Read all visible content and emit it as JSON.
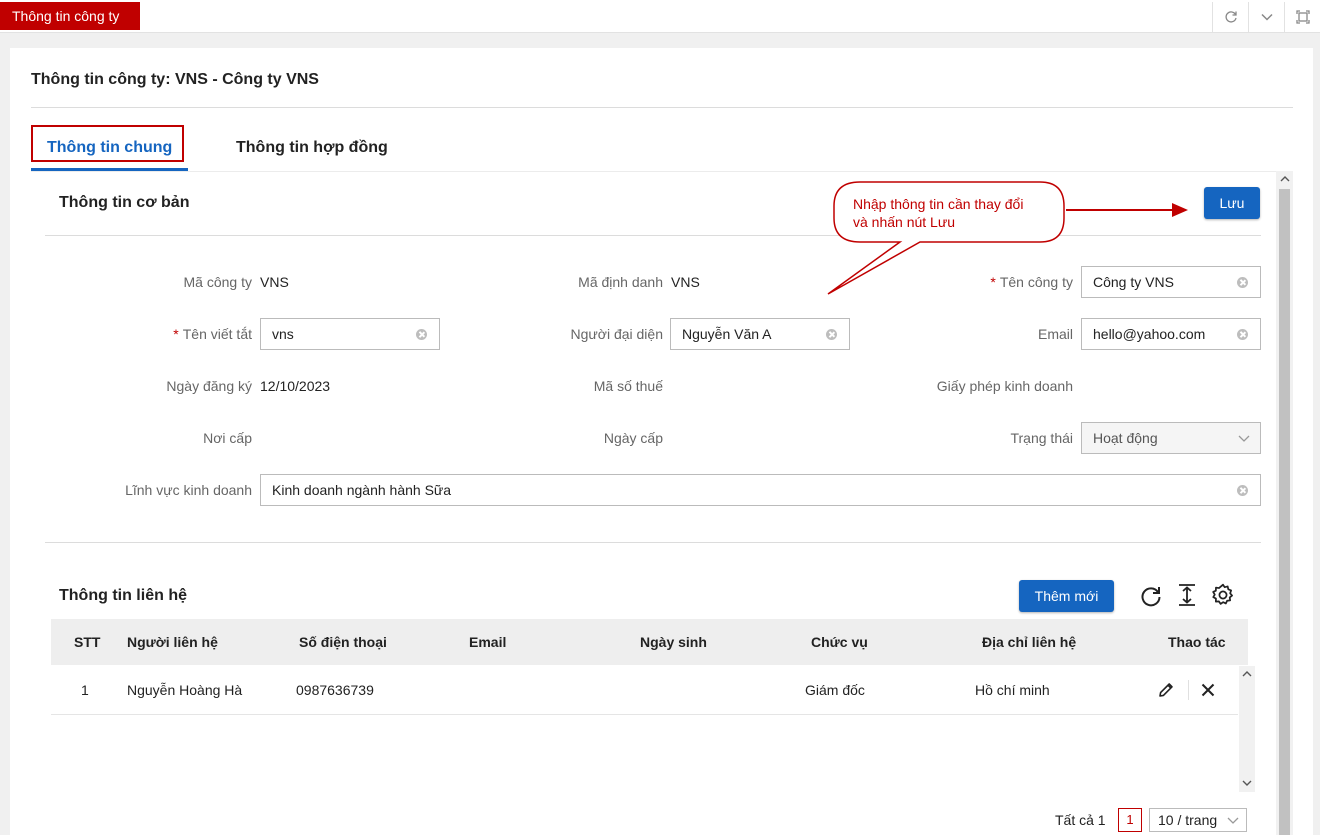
{
  "header": {
    "page_tab": "Thông tin công ty"
  },
  "card": {
    "title": "Thông tin công ty: VNS - Công ty VNS"
  },
  "tabs": [
    {
      "label": "Thông tin chung"
    },
    {
      "label": "Thông tin hợp đồng"
    }
  ],
  "basic": {
    "title": "Thông tin cơ bản",
    "save_label": "Lưu",
    "callout": [
      "Nhập thông tin cần thay đổi",
      "và nhấn nút Lưu"
    ],
    "fields": {
      "ma_cong_ty": {
        "label": "Mã công ty",
        "value": "VNS"
      },
      "ma_dinh_danh": {
        "label": "Mã định danh",
        "value": "VNS"
      },
      "ten_cong_ty": {
        "required": "*",
        "label": "Tên công ty",
        "value": "Công ty VNS"
      },
      "ten_viet_tat": {
        "required": "*",
        "label": "Tên viết tắt",
        "value": "vns"
      },
      "nguoi_dai_dien": {
        "label": "Người đại diện",
        "value": "Nguyễn Văn A"
      },
      "email": {
        "label": "Email",
        "value": "hello@yahoo.com"
      },
      "ngay_dang_ky": {
        "label": "Ngày đăng ký",
        "value": "12/10/2023"
      },
      "ma_so_thue": {
        "label": "Mã số thuế"
      },
      "giay_phep": {
        "label": "Giấy phép kinh doanh"
      },
      "noi_cap": {
        "label": "Nơi cấp"
      },
      "ngay_cap": {
        "label": "Ngày cấp"
      },
      "trang_thai": {
        "label": "Trạng thái",
        "value": "Hoạt động"
      },
      "linh_vuc": {
        "label": "Lĩnh vực kinh doanh",
        "value": "Kinh doanh ngành hành Sữa"
      }
    }
  },
  "contacts": {
    "title": "Thông tin liên hệ",
    "add_label": "Thêm mới",
    "columns": [
      "STT",
      "Người liên hệ",
      "Số điện thoại",
      "Email",
      "Ngày sinh",
      "Chức vụ",
      "Địa chỉ liên hệ",
      "Thao tác"
    ],
    "rows": [
      {
        "stt": "1",
        "name": "Nguyễn Hoàng Hà",
        "phone": "0987636739",
        "email": "",
        "birthday": "",
        "position": "Giám đốc",
        "address": "Hồ chí minh"
      }
    ]
  },
  "pagination": {
    "total": "Tất cả 1",
    "page": "1",
    "page_size": "10 / trang"
  },
  "colors": {
    "brand_red": "#c00000",
    "primary_blue": "#1565c0"
  },
  "icons": [
    "refresh-icon",
    "chevron-down-icon",
    "maximize-icon",
    "clear-icon",
    "reload-icon",
    "column-height-icon",
    "gear-icon",
    "edit-icon",
    "close-icon"
  ]
}
